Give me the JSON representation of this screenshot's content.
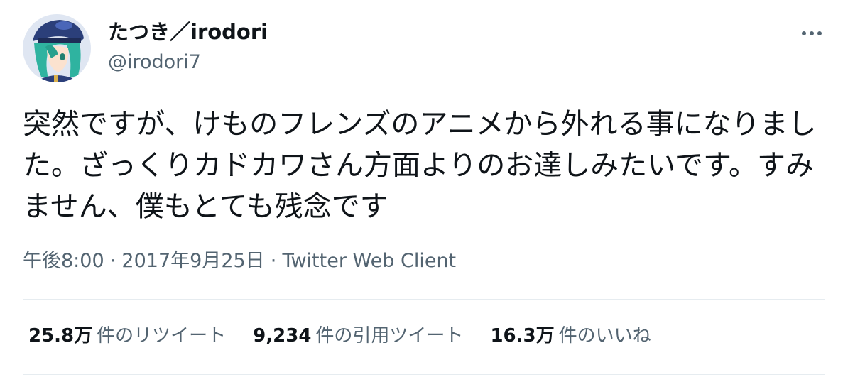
{
  "author": {
    "display_name": "たつき／irodori",
    "handle": "@irodori7",
    "avatar_icon": "avatar-icon"
  },
  "more_icon": "more-horizontal-icon",
  "tweet": {
    "text": "突然ですが、けものフレンズのアニメから外れる事になりました。ざっくりカドカワさん方面よりのお達しみたいです。すみません、僕もとても残念です",
    "time": "午後8:00",
    "separator": "·",
    "date": "2017年9月25日",
    "source": "Twitter Web Client"
  },
  "stats": {
    "retweets": {
      "count": "25.8万",
      "label": "件のリツイート"
    },
    "quotes": {
      "count": "9,234",
      "label": "件の引用ツイート"
    },
    "likes": {
      "count": "16.3万",
      "label": "件のいいね"
    }
  },
  "colors": {
    "text_primary": "#0f1419",
    "text_secondary": "#536471",
    "divider": "#e6ecf0"
  }
}
